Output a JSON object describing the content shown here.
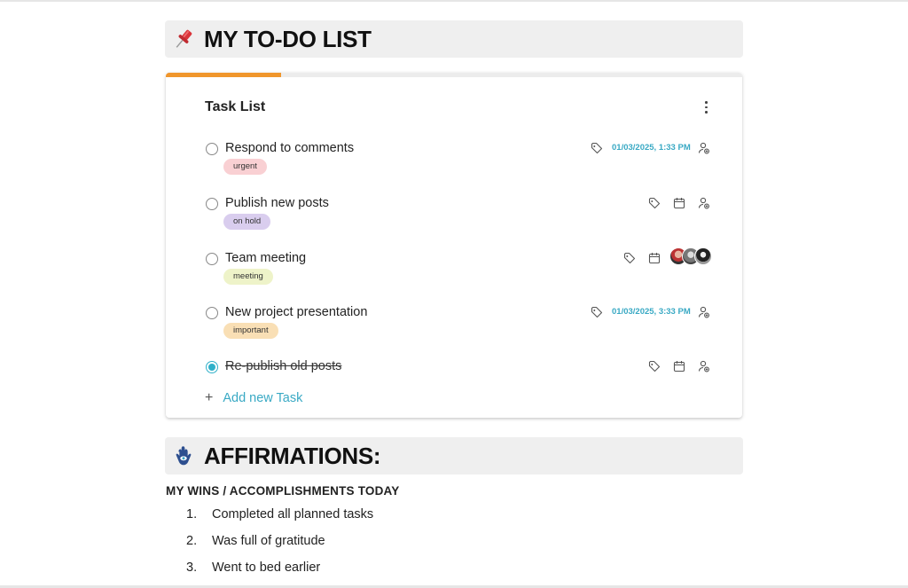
{
  "header_todo": {
    "icon": "pushpin-icon",
    "title": "MY TO-DO LIST"
  },
  "card": {
    "title": "Task List",
    "progress": 0.2,
    "accent_color": "#f0962c",
    "tasks": [
      {
        "name": "Respond to comments",
        "tag": "urgent",
        "tag_color": "#f9d0d3",
        "due": "01/03/2025, 1:33 PM",
        "completed": false
      },
      {
        "name": "Publish new posts",
        "tag": "on hold",
        "tag_color": "#d9cdee",
        "due": "",
        "completed": false
      },
      {
        "name": "Team meeting",
        "tag": "meeting",
        "tag_color": "#eef3c9",
        "due": "",
        "completed": false
      },
      {
        "name": "New project presentation",
        "tag": "important",
        "tag_color": "#f9dfb5",
        "due": "01/03/2025, 3:33 PM",
        "completed": false
      },
      {
        "name": "Re-publish old posts",
        "tag": "",
        "tag_color": "",
        "due": "",
        "completed": true
      }
    ],
    "add_label": "Add new Task"
  },
  "header_affirmations": {
    "icon": "hamsa-hand-icon",
    "title": "AFFIRMATIONS:"
  },
  "wins": {
    "title": "MY WINS / ACCOMPLISHMENTS TODAY",
    "items": [
      {
        "num": "1.",
        "text": "Completed all planned tasks"
      },
      {
        "num": "2.",
        "text": "Was full of gratitude"
      },
      {
        "num": "3.",
        "text": "Went to bed earlier"
      }
    ]
  }
}
